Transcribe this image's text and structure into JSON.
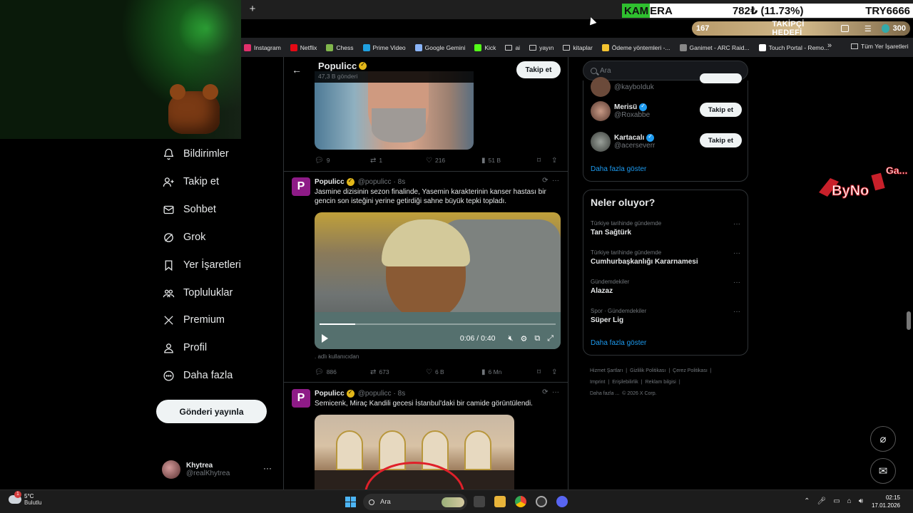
{
  "overlay": {
    "ticker": {
      "symbol_part1": "KAM",
      "symbol_part2": "ERA",
      "price": "782₺ (11.73%)",
      "currency": "TRY6666"
    },
    "goal": {
      "count": "167",
      "label": "TAKİPÇİ HEDEFİ",
      "total": "300"
    }
  },
  "browser": {
    "new_tab": "+",
    "bookmarks": [
      {
        "label": "Instagram",
        "icon": "instagram-icon",
        "color": "#e1306c"
      },
      {
        "label": "Netflix",
        "icon": "netflix-icon",
        "color": "#e50914"
      },
      {
        "label": "Chess",
        "icon": "chess-icon",
        "color": "#81b64c"
      },
      {
        "label": "Prime Video",
        "icon": "prime-video-icon",
        "color": "#1fa0e0"
      },
      {
        "label": "Google Gemini",
        "icon": "gemini-icon",
        "color": "#8ab4f8"
      },
      {
        "label": "Kick",
        "icon": "kick-icon",
        "color": "#53fc18"
      },
      {
        "label": "ai",
        "icon": "folder-icon",
        "color": ""
      },
      {
        "label": "yayın",
        "icon": "folder-icon",
        "color": ""
      },
      {
        "label": "kitaplar",
        "icon": "folder-icon",
        "color": ""
      },
      {
        "label": "Ödeme yöntemleri -...",
        "icon": "payment-icon",
        "color": "#f4c430"
      },
      {
        "label": "Ganimet - ARC Raid...",
        "icon": "arc-raiders-icon",
        "color": "#888888"
      },
      {
        "label": "Touch Portal - Remo...",
        "icon": "touch-portal-icon",
        "color": "#ffffff"
      }
    ],
    "bookmarks_more": "»",
    "all_bookmarks": "Tüm Yer İşaretleri"
  },
  "nav": {
    "items": [
      {
        "label": "Bildirimler",
        "icon": "bell-icon"
      },
      {
        "label": "Takip et",
        "icon": "add-user-icon"
      },
      {
        "label": "Sohbet",
        "icon": "mail-icon"
      },
      {
        "label": "Grok",
        "icon": "grok-icon"
      },
      {
        "label": "Yer İşaretleri",
        "icon": "bookmark-icon"
      },
      {
        "label": "Topluluklar",
        "icon": "communities-icon"
      },
      {
        "label": "Premium",
        "icon": "x-logo-icon"
      },
      {
        "label": "Profil",
        "icon": "person-icon"
      },
      {
        "label": "Daha fazla",
        "icon": "more-circle-icon"
      }
    ],
    "post_button": "Gönderi yayınla",
    "account": {
      "name": "Khytrea",
      "handle": "@realKhytrea",
      "more": "···"
    }
  },
  "profile_header": {
    "back": "←",
    "name": "Populicc",
    "post_count": "47,3 B gönderi",
    "follow": "Takip et"
  },
  "tweets": [
    {
      "actions": {
        "replies": "9",
        "reposts": "1",
        "likes": "216",
        "views": "51 B"
      }
    },
    {
      "avatar": "P",
      "name": "Populicc",
      "handle": "@populicc",
      "time": "· 8s",
      "text": "Jasmine dizisinin sezon finalinde, Yasemin karakterinin kanser hastası bir gencin son isteğini yerine getirdiği sahne büyük tepki topladı.",
      "video": {
        "time": "0:06 / 0:40",
        "progress": 0.15
      },
      "caption": ". adlı kullanıcıdan",
      "actions": {
        "replies": "886",
        "reposts": "673",
        "likes": "6 B",
        "views": "6 Mn"
      }
    },
    {
      "avatar": "P",
      "name": "Populicc",
      "handle": "@populicc",
      "time": "· 8s",
      "text": "Semicenk, Miraç Kandili gecesi İstanbul'daki bir camide görüntülendi."
    }
  ],
  "right": {
    "search_placeholder": "Ara",
    "who_to_follow": [
      {
        "name": "",
        "handle": "@kayboIduk",
        "button": ""
      },
      {
        "name": "Merisü",
        "handle": "@Roxabbe",
        "button": "Takip et"
      },
      {
        "name": "Kartacalı",
        "handle": "@acerseverr",
        "button": "Takip et"
      }
    ],
    "show_more_1": "Daha fazla göster",
    "trends_title": "Neler oluyor?",
    "trends": [
      {
        "context": "Türkiye tarihinde gündemde",
        "title": "Tan Sağtürk"
      },
      {
        "context": "Türkiye tarihinde gündemde",
        "title": "Cumhurbaşkanlığı Kararnamesi"
      },
      {
        "context": "Gündemdekiler",
        "title": "Alazaz"
      },
      {
        "context": "Spor · Gündemdekiler",
        "title": "Süper Lig"
      }
    ],
    "show_more_2": "Daha fazla göster",
    "footer": [
      "Hizmet Şartları",
      "|",
      "Gizlilik Politikası",
      "|",
      "Çerez Politikası",
      "|",
      "Imprint",
      "|",
      "Erişilebilirlik",
      "|",
      "Reklam bilgisi",
      "|",
      "Daha fazla ...",
      "© 2026 X Corp."
    ]
  },
  "byno_text": "ByNo",
  "byno_ga": "Ga...",
  "taskbar": {
    "temp": "5°C",
    "weather": "Bulutlu",
    "weather_badge": "1",
    "search": "Ara",
    "time": "02:15",
    "date": "17.01.2026"
  }
}
